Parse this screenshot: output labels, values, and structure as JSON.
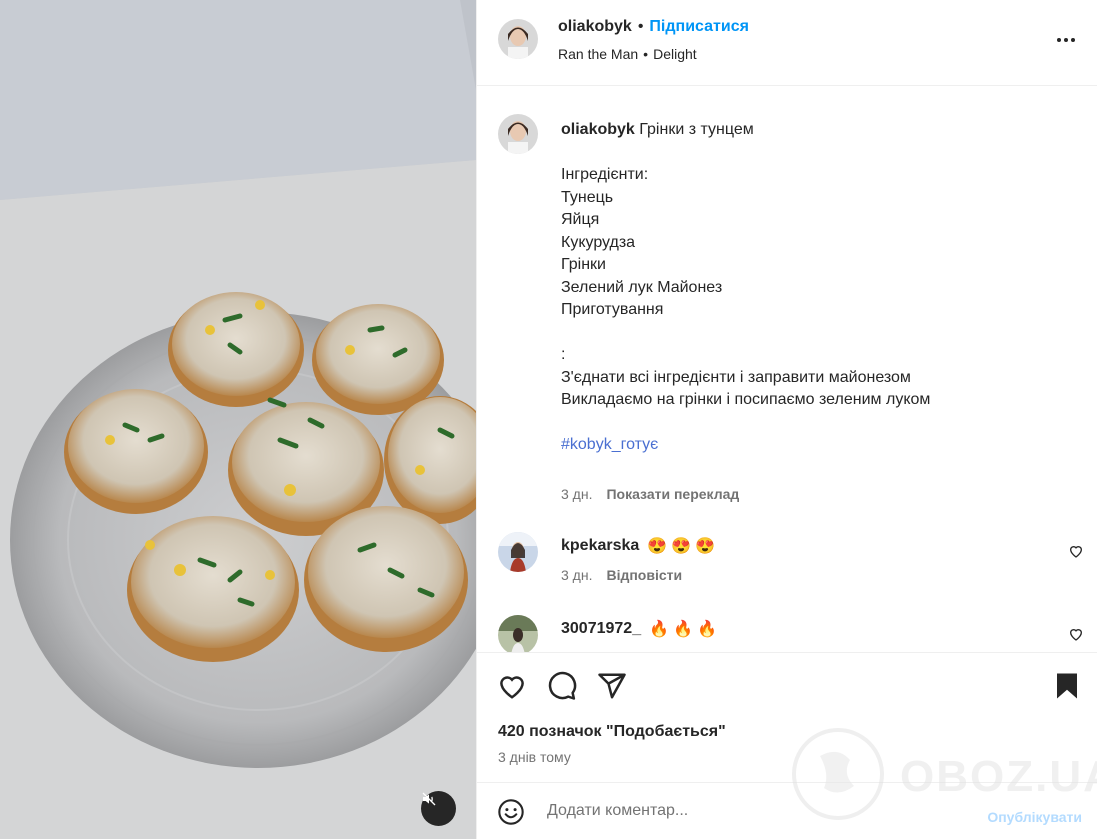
{
  "post": {
    "username": "oliakobyk",
    "follow_label": "Підписатися",
    "audio_artist": "Ran the Man",
    "audio_title": "Delight",
    "audio_separator": "•",
    "header_separator": "•"
  },
  "caption": {
    "username": "oliakobyk",
    "title": "Грінки з тунцем",
    "lines": [
      "",
      "Інгредієнти:",
      "Тунець",
      "Яйця",
      "Кукурудза",
      "Грінки",
      "Зелений лук Майонез",
      "Приготування",
      "",
      ":",
      "З'єднати всі інгредієнти і заправити майонезом",
      "Викладаємо на грінки і посипаємо зеленим луком",
      ""
    ],
    "hashtag": "#kobyk_готує",
    "time": "3 дн.",
    "translate_label": "Показати переклад"
  },
  "comments": [
    {
      "username": "kpekarska",
      "emoji": [
        "😍",
        "😍",
        "😍"
      ],
      "time": "3 дн.",
      "reply_label": "Відповісти"
    },
    {
      "username": "30071972_",
      "emoji": [
        "🔥",
        "🔥",
        "🔥"
      ]
    }
  ],
  "stats": {
    "likes_text": "420 позначок \"Подобається\"",
    "posted_ago": "3 днів тому"
  },
  "composer": {
    "placeholder": "Додати коментар...",
    "publish_label": "Опублікувати"
  },
  "watermark": {
    "text": "OBOZ.UA"
  },
  "colors": {
    "accent": "#0095f6",
    "text": "#262626",
    "muted": "#737373",
    "hashtag": "#4a6fd1"
  },
  "icons": {
    "more": "more-horizontal-icon",
    "like": "heart-icon",
    "comment": "comment-icon",
    "share": "share-icon",
    "save": "bookmark-icon",
    "emoji": "emoji-icon",
    "mute": "muted-speaker-icon"
  }
}
